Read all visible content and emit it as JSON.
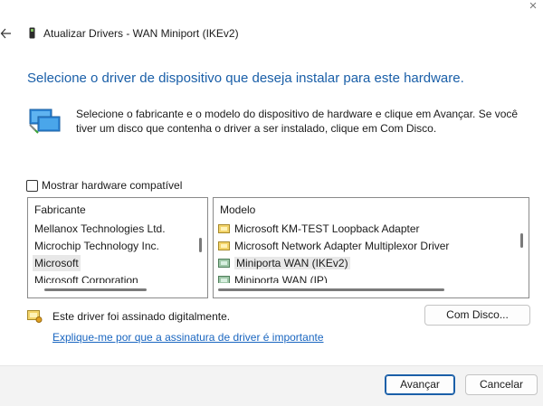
{
  "window": {
    "title": "Atualizar Drivers - WAN Miniport (IKEv2)",
    "close_glyph": "×"
  },
  "main": {
    "heading": "Selecione o driver de dispositivo que deseja instalar para este hardware.",
    "description": "Selecione o fabricante e o modelo do dispositivo de hardware e clique em Avançar. Se você tiver um disco que contenha o driver a ser instalado, clique em Com Disco."
  },
  "compatible": {
    "label": "Mostrar hardware compatível",
    "checked": false
  },
  "manufacturers": {
    "header": "Fabricante",
    "items": [
      "Mellanox Technologies Ltd.",
      "Microchip Technology Inc.",
      "Microsoft",
      "Microsoft Corporation"
    ],
    "selected": "Microsoft"
  },
  "models": {
    "header": "Modelo",
    "items": [
      "Microsoft KM-TEST Loopback Adapter",
      "Microsoft Network Adapter Multiplexor Driver",
      "Miniporta WAN (IKEv2)",
      "Miniporta WAN (IP)"
    ],
    "selected": "Miniporta WAN (IKEv2)"
  },
  "signature": {
    "text": "Este driver foi assinado digitalmente.",
    "link": "Explique-me por que a assinatura de driver é importante"
  },
  "buttons": {
    "have_disk": "Com Disco...",
    "next": "Avançar",
    "cancel": "Cancelar"
  },
  "colors": {
    "accent": "#1a5fa8",
    "link": "#1a66c0",
    "footer": "#f3f3f3"
  },
  "icons": {
    "back": "back-arrow-icon",
    "title": "device-icon",
    "hardware": "network-adapter-icon",
    "driver": "driver-icon",
    "signed": "signed-driver-icon"
  }
}
